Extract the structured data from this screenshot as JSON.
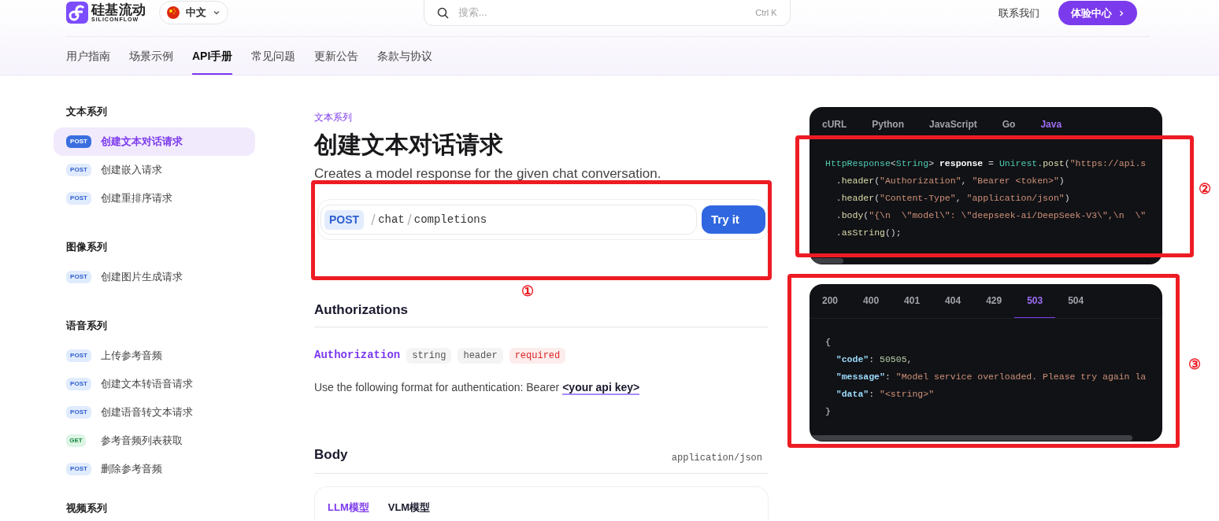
{
  "header": {
    "logo_text": "硅基流动",
    "logo_subtext": "SILICONFLOW",
    "language": "中文",
    "search": {
      "placeholder": "搜索...",
      "shortcut": "Ctrl K"
    },
    "contact": "联系我们",
    "cta": "体验中心"
  },
  "nav_tabs": [
    {
      "label": "用户指南",
      "selected": false
    },
    {
      "label": "场景示例",
      "selected": false
    },
    {
      "label": "API手册",
      "selected": true
    },
    {
      "label": "常见问题",
      "selected": false
    },
    {
      "label": "更新公告",
      "selected": false
    },
    {
      "label": "条款与协议",
      "selected": false
    }
  ],
  "sidebar": {
    "groups": [
      {
        "title": "文本系列",
        "items": [
          {
            "method": "POST",
            "label": "创建文本对话请求",
            "selected": true
          },
          {
            "method": "POST",
            "label": "创建嵌入请求",
            "selected": false
          },
          {
            "method": "POST",
            "label": "创建重排序请求",
            "selected": false
          }
        ]
      },
      {
        "title": "图像系列",
        "items": [
          {
            "method": "POST",
            "label": "创建图片生成请求",
            "selected": false
          }
        ]
      },
      {
        "title": "语音系列",
        "items": [
          {
            "method": "POST",
            "label": "上传参考音频",
            "selected": false
          },
          {
            "method": "POST",
            "label": "创建文本转语音请求",
            "selected": false
          },
          {
            "method": "POST",
            "label": "创建语音转文本请求",
            "selected": false
          },
          {
            "method": "GET",
            "label": "参考音频列表获取",
            "selected": false
          },
          {
            "method": "POST",
            "label": "删除参考音频",
            "selected": false
          }
        ]
      },
      {
        "title": "视频系列"
      }
    ]
  },
  "main": {
    "breadcrumb": "文本系列",
    "title": "创建文本对话请求",
    "description": "Creates a model response for the given chat conversation.",
    "endpoint": {
      "method": "POST",
      "path": [
        "chat",
        "completions"
      ],
      "button": "Try it"
    },
    "authorizations": {
      "heading": "Authorizations",
      "param": {
        "name": "Authorization",
        "tags": [
          {
            "text": "string",
            "kind": "type"
          },
          {
            "text": "header",
            "kind": "type"
          },
          {
            "text": "required",
            "kind": "required"
          }
        ]
      },
      "description_prefix": "Use the following format for authentication: Bearer",
      "description_link": "<your api key>"
    },
    "body": {
      "heading": "Body",
      "content_type": "application/json",
      "tabs": [
        {
          "label": "LLM模型",
          "selected": true
        },
        {
          "label": "VLM模型",
          "selected": false
        }
      ]
    }
  },
  "code_panel": {
    "tabs": [
      {
        "label": "cURL",
        "selected": false
      },
      {
        "label": "Python",
        "selected": false
      },
      {
        "label": "JavaScript",
        "selected": false
      },
      {
        "label": "Go",
        "selected": false
      },
      {
        "label": "Java",
        "selected": true
      }
    ],
    "lines": [
      [
        {
          "text": "HttpResponse",
          "kind": "type"
        },
        {
          "text": "<",
          "kind": "plain"
        },
        {
          "text": "String",
          "kind": "type"
        },
        {
          "text": "> ",
          "kind": "plain"
        },
        {
          "text": "response",
          "kind": "var"
        },
        {
          "text": " = ",
          "kind": "plain"
        },
        {
          "text": "Unirest",
          "kind": "type"
        },
        {
          "text": ".",
          "kind": "plain"
        },
        {
          "text": "post",
          "kind": "method"
        },
        {
          "text": "(",
          "kind": "plain"
        },
        {
          "text": "\"https://api.s",
          "kind": "string"
        }
      ],
      [
        {
          "text": "  .",
          "kind": "plain"
        },
        {
          "text": "header",
          "kind": "method"
        },
        {
          "text": "(",
          "kind": "plain"
        },
        {
          "text": "\"Authorization\"",
          "kind": "string"
        },
        {
          "text": ", ",
          "kind": "plain"
        },
        {
          "text": "\"Bearer <token>\"",
          "kind": "string"
        },
        {
          "text": ")",
          "kind": "plain"
        }
      ],
      [
        {
          "text": "  .",
          "kind": "plain"
        },
        {
          "text": "header",
          "kind": "method"
        },
        {
          "text": "(",
          "kind": "plain"
        },
        {
          "text": "\"Content-Type\"",
          "kind": "string"
        },
        {
          "text": ", ",
          "kind": "plain"
        },
        {
          "text": "\"application/json\"",
          "kind": "string"
        },
        {
          "text": ")",
          "kind": "plain"
        }
      ],
      [
        {
          "text": "  .",
          "kind": "plain"
        },
        {
          "text": "body",
          "kind": "method"
        },
        {
          "text": "(",
          "kind": "plain"
        },
        {
          "text": "\"{\\n  \\\"model\\\": \\\"deepseek-ai/DeepSeek-V3\\\",\\n  \\\"",
          "kind": "string"
        }
      ],
      [
        {
          "text": "  .",
          "kind": "plain"
        },
        {
          "text": "asString",
          "kind": "method"
        },
        {
          "text": "();",
          "kind": "plain"
        }
      ]
    ]
  },
  "response_panel": {
    "tabs": [
      {
        "label": "200",
        "selected": false
      },
      {
        "label": "400",
        "selected": false
      },
      {
        "label": "401",
        "selected": false
      },
      {
        "label": "404",
        "selected": false
      },
      {
        "label": "429",
        "selected": false
      },
      {
        "label": "503",
        "selected": true
      },
      {
        "label": "504",
        "selected": false
      }
    ],
    "lines": [
      [
        {
          "text": "{",
          "kind": "plain"
        }
      ],
      [
        {
          "text": "  \"code\"",
          "kind": "key"
        },
        {
          "text": ": ",
          "kind": "plain"
        },
        {
          "text": "50505",
          "kind": "number"
        },
        {
          "text": ",",
          "kind": "plain"
        }
      ],
      [
        {
          "text": "  \"message\"",
          "kind": "key"
        },
        {
          "text": ": ",
          "kind": "plain"
        },
        {
          "text": "\"Model service overloaded. Please try again la",
          "kind": "string"
        }
      ],
      [
        {
          "text": "  \"data\"",
          "kind": "key"
        },
        {
          "text": ": ",
          "kind": "plain"
        },
        {
          "text": "\"<string>\"",
          "kind": "string"
        }
      ],
      [
        {
          "text": "}",
          "kind": "plain"
        }
      ]
    ]
  },
  "annotations": [
    {
      "label": "①"
    },
    {
      "label": "②"
    },
    {
      "label": "③"
    }
  ]
}
